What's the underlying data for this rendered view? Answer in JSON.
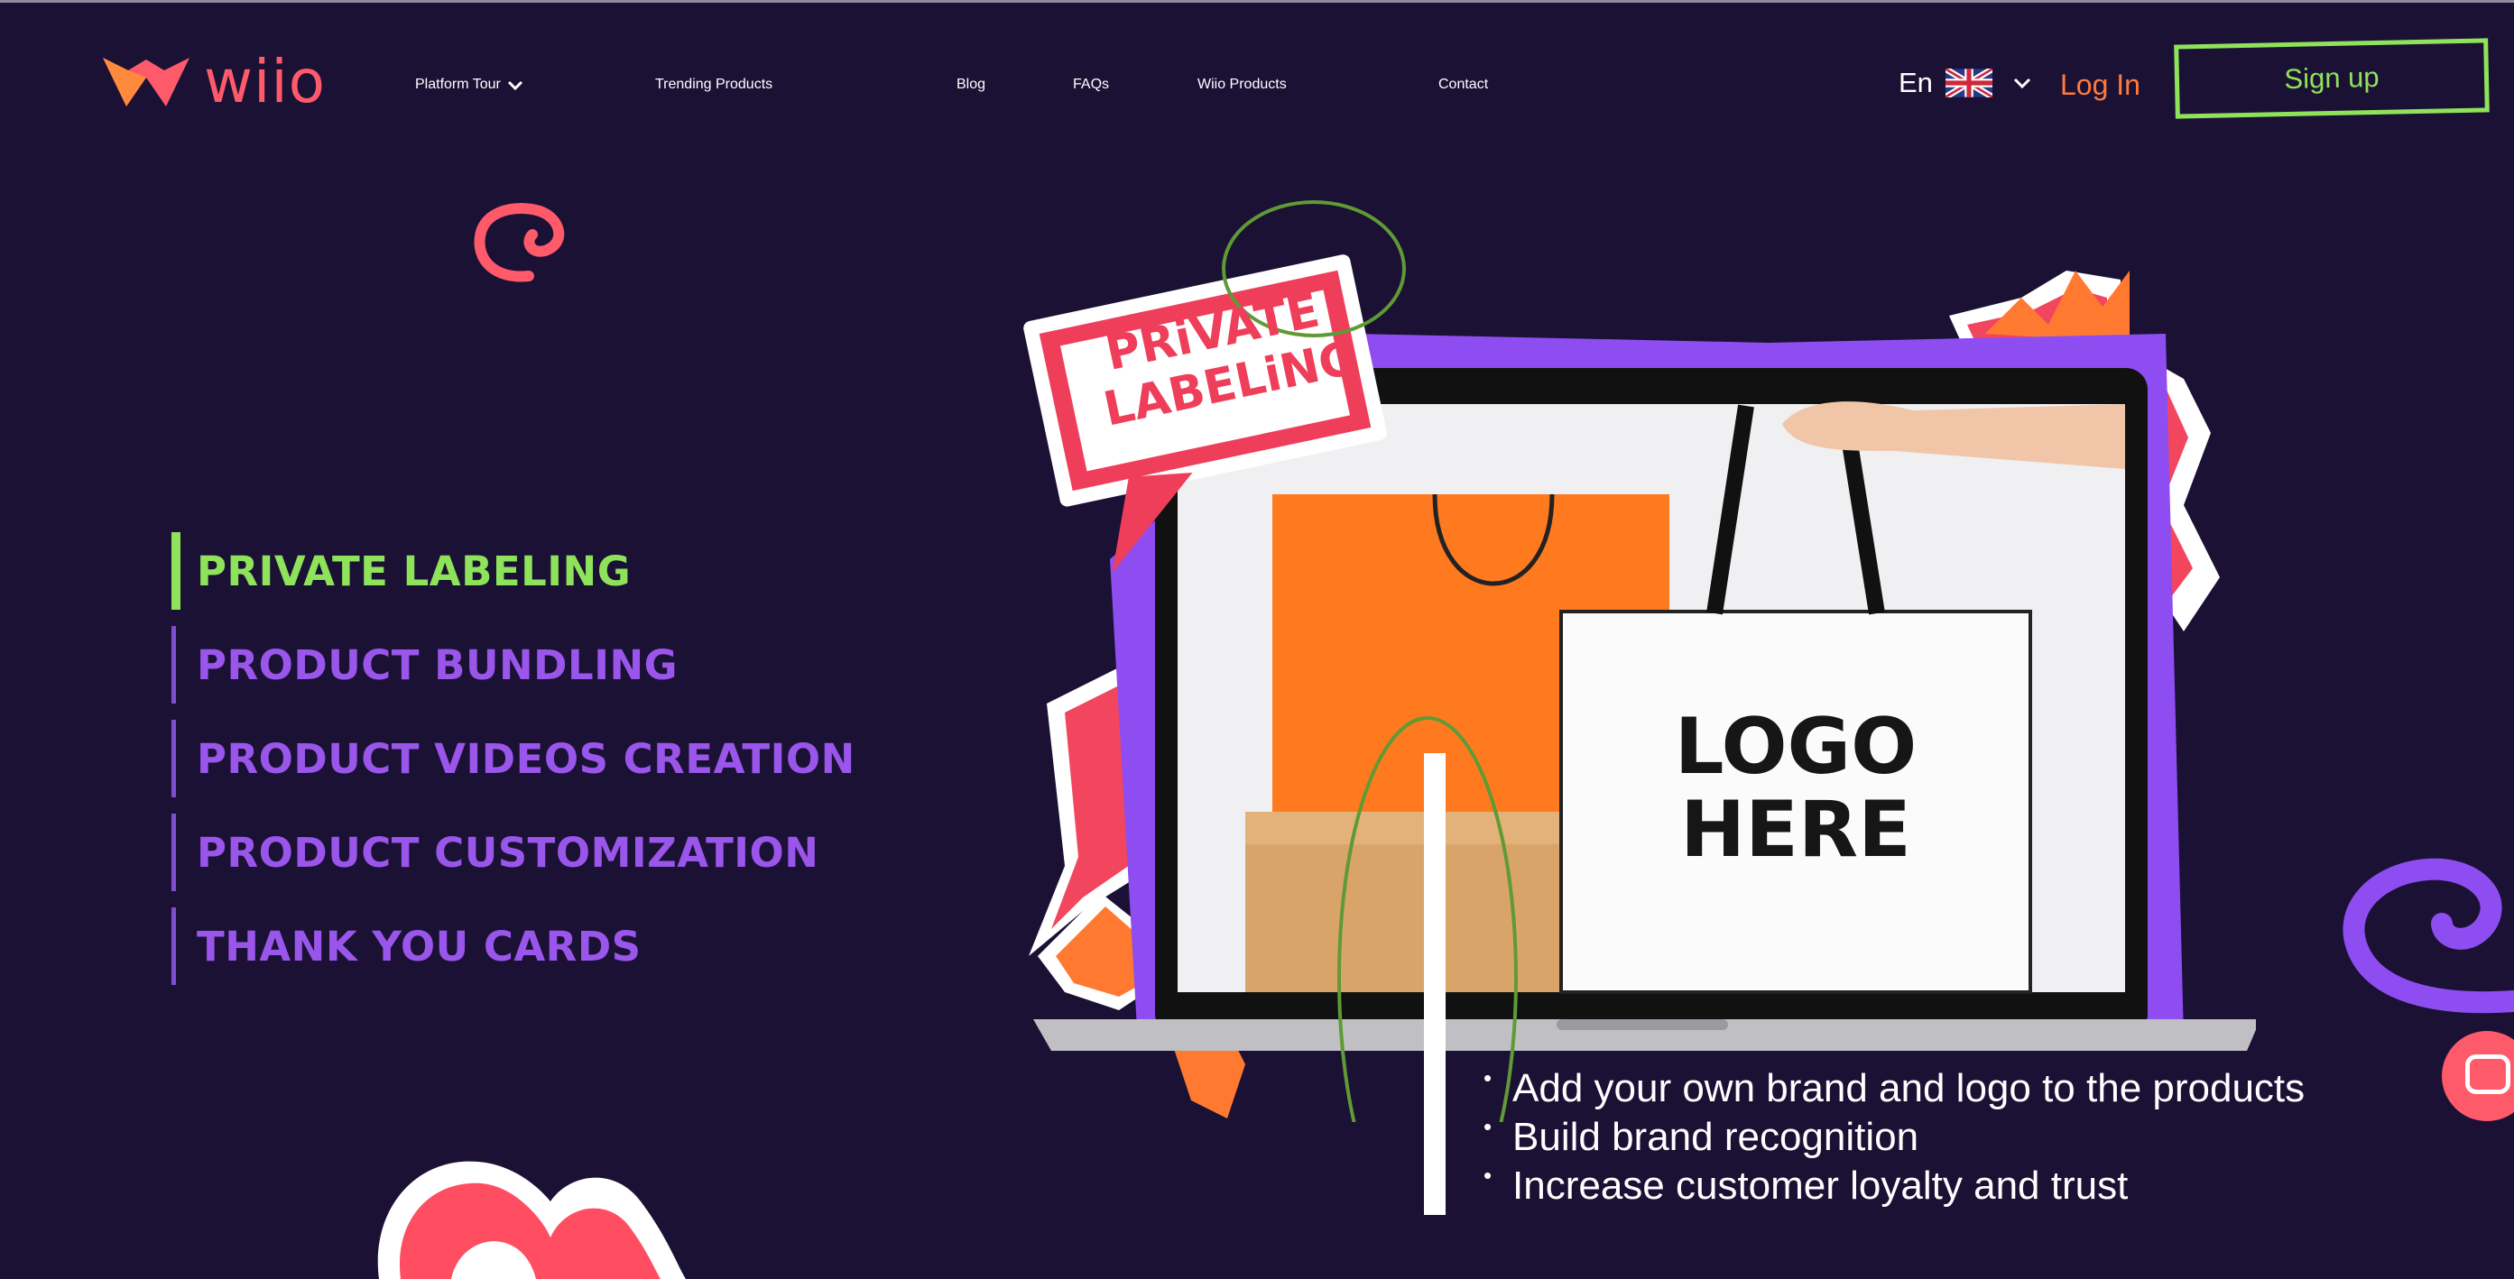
{
  "brand": {
    "name": "wiio"
  },
  "nav": {
    "items": [
      {
        "label": "Platform Tour"
      },
      {
        "label": "Trending Products"
      },
      {
        "label": "Blog"
      },
      {
        "label": "FAQs"
      },
      {
        "label": "Wiio Products"
      },
      {
        "label": "Contact"
      }
    ]
  },
  "header": {
    "language": "En",
    "login_label": "Log In",
    "signup_label": "Sign up"
  },
  "features": [
    {
      "label": "PRIVATE LABELING",
      "active": true
    },
    {
      "label": "PRODUCT BUNDLING",
      "active": false
    },
    {
      "label": "PRODUCT VIDEOS CREATION",
      "active": false
    },
    {
      "label": "PRODUCT CUSTOMIZATION",
      "active": false
    },
    {
      "label": "THANK YOU CARDS",
      "active": false
    }
  ],
  "hero": {
    "sticker_line1": "PRiVATE",
    "sticker_line2": "LABELiNG",
    "bag_logo_line1": "LOGO",
    "bag_logo_line2": "HERE"
  },
  "bullets": [
    "Add your own brand and logo to the products",
    "Build brand recognition",
    "Increase customer loyalty and trust"
  ],
  "colors": {
    "background": "#1b1135",
    "accent_green": "#8ee35a",
    "accent_purple": "#9a56ea",
    "accent_coral": "#ff5a6a",
    "accent_orange": "#ff7a3d"
  },
  "icons": [
    "wiio-logo-icon",
    "chevron-down-icon",
    "uk-flag-icon",
    "chat-icon"
  ]
}
